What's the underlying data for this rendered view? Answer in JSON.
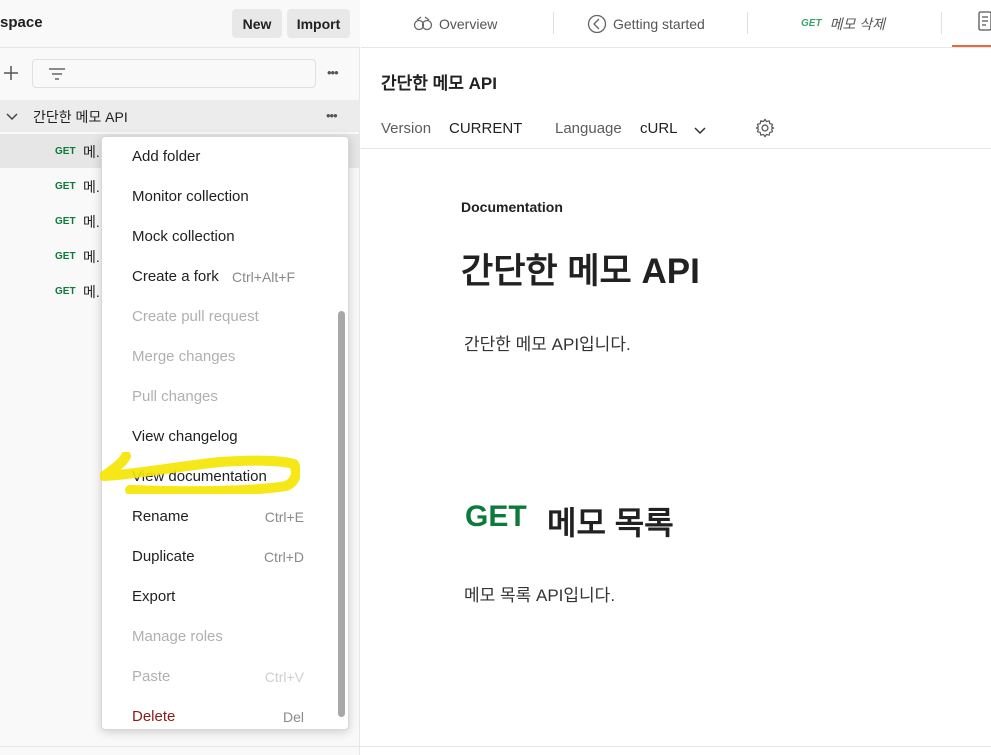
{
  "sidebar": {
    "workspace_name": "space",
    "new_label": "New",
    "import_label": "Import",
    "more_label": "•••",
    "collection": {
      "name": "간단한 메모 API",
      "more_label": "•••"
    },
    "requests": [
      {
        "method": "GET",
        "name": "메."
      },
      {
        "method": "GET",
        "name": "메."
      },
      {
        "method": "GET",
        "name": "메."
      },
      {
        "method": "GET",
        "name": "메."
      },
      {
        "method": "GET",
        "name": "메."
      }
    ]
  },
  "context_menu": {
    "items": [
      {
        "label": "Add folder",
        "shortcut": ""
      },
      {
        "label": "Monitor collection",
        "shortcut": ""
      },
      {
        "label": "Mock collection",
        "shortcut": ""
      },
      {
        "label": "Create a fork",
        "shortcut": "Ctrl+Alt+F"
      },
      {
        "label": "Create pull request",
        "shortcut": ""
      },
      {
        "label": "Merge changes",
        "shortcut": ""
      },
      {
        "label": "Pull changes",
        "shortcut": ""
      },
      {
        "label": "View changelog",
        "shortcut": ""
      },
      {
        "label": "View documentation",
        "shortcut": ""
      },
      {
        "label": "Rename",
        "shortcut": "Ctrl+E"
      },
      {
        "label": "Duplicate",
        "shortcut": "Ctrl+D"
      },
      {
        "label": "Export",
        "shortcut": ""
      },
      {
        "label": "Manage roles",
        "shortcut": ""
      },
      {
        "label": "Paste",
        "shortcut": "Ctrl+V"
      },
      {
        "label": "Delete",
        "shortcut": "Del"
      }
    ]
  },
  "tabs": {
    "overview": "Overview",
    "getting_started": "Getting started",
    "request_method": "GET",
    "request_name": "메모 삭제"
  },
  "doc_header": {
    "title": "간단한 메모 API",
    "version_label": "Version",
    "version_value": "CURRENT",
    "language_label": "Language",
    "language_value": "cURL"
  },
  "documentation": {
    "section_label": "Documentation",
    "heading": "간단한 메모 API",
    "description": "간단한 메모 API입니다.",
    "endpoint": {
      "method": "GET",
      "name": "메모 목록",
      "description": "메모 목록 API입니다."
    }
  },
  "colors": {
    "get_method": "#0c7a3a",
    "accent": "#e8693c",
    "highlight": "#f5e400"
  }
}
